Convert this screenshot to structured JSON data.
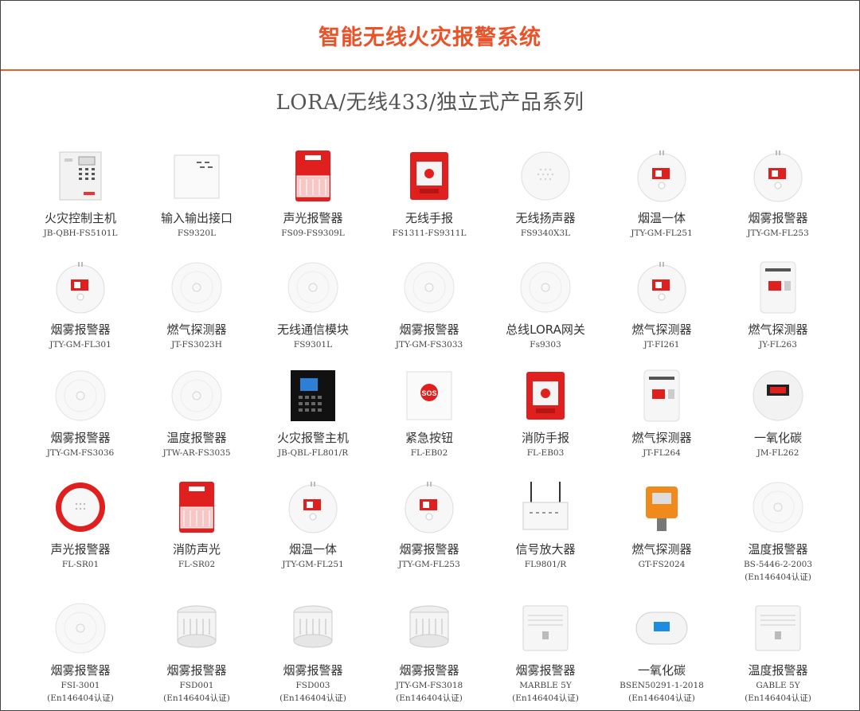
{
  "header": {
    "title": "智能无线火灾报警系统"
  },
  "subtitle": "LORA/无线433/独立式产品系列",
  "products": [
    {
      "name": "火灾控制主机",
      "model": "JB-QBH-FS5101L",
      "icon": "control-panel-icon"
    },
    {
      "name": "输入输出接口",
      "model": "FS9320L",
      "icon": "io-module-icon"
    },
    {
      "name": "声光报警器",
      "model": "FS09-FS9309L",
      "icon": "red-strobe-icon"
    },
    {
      "name": "无线手报",
      "model": "FS1311-FS9311L",
      "icon": "manual-call-point-icon"
    },
    {
      "name": "无线扬声器",
      "model": "FS9340X3L",
      "icon": "speaker-icon"
    },
    {
      "name": "烟温一体",
      "model": "JTY-GM-FL251",
      "icon": "smoke-detector-icon"
    },
    {
      "name": "烟雾报警器",
      "model": "JTY-GM-FL253",
      "icon": "smoke-detector-icon"
    },
    {
      "name": "烟雾报警器",
      "model": "JTY-GM-FL301",
      "icon": "smoke-detector-icon"
    },
    {
      "name": "燃气探测器",
      "model": "JT-FS3023H",
      "icon": "round-detector-icon"
    },
    {
      "name": "无线通信模块",
      "model": "FS9301L",
      "icon": "round-detector-icon"
    },
    {
      "name": "烟雾报警器",
      "model": "JTY-GM-FS3033",
      "icon": "round-detector-icon"
    },
    {
      "name": "总线LORA网关",
      "model": "Fs9303",
      "icon": "round-detector-icon"
    },
    {
      "name": "燃气探测器",
      "model": "JT-FI261",
      "icon": "smoke-detector-icon"
    },
    {
      "name": "燃气探测器",
      "model": "JY-FL263",
      "icon": "gas-detector-box-icon"
    },
    {
      "name": "烟雾报警器",
      "model": "JTY-GM-FS3036",
      "icon": "round-detector-icon"
    },
    {
      "name": "温度报警器",
      "model": "JTW-AR-FS3035",
      "icon": "round-detector-icon"
    },
    {
      "name": "火灾报警主机",
      "model": "JB-QBL-FL801/R",
      "icon": "alarm-host-icon"
    },
    {
      "name": "紧急按钮",
      "model": "FL-EB02",
      "icon": "sos-button-icon"
    },
    {
      "name": "消防手报",
      "model": "FL-EB03",
      "icon": "manual-call-point-icon"
    },
    {
      "name": "燃气探测器",
      "model": "JT-FL264",
      "icon": "gas-detector-box-icon"
    },
    {
      "name": "一氧化碳",
      "model": "JM-FL262",
      "icon": "co-detector-icon"
    },
    {
      "name": "声光报警器",
      "model": "FL-SR01",
      "icon": "round-siren-icon"
    },
    {
      "name": "消防声光",
      "model": "FL-SR02",
      "icon": "red-strobe-icon"
    },
    {
      "name": "烟温一体",
      "model": "JTY-GM-FL251",
      "icon": "smoke-detector-icon"
    },
    {
      "name": "烟雾报警器",
      "model": "JTY-GM-FL253",
      "icon": "smoke-detector-icon"
    },
    {
      "name": "信号放大器",
      "model": "FL9801/R",
      "icon": "router-icon"
    },
    {
      "name": "燃气探测器",
      "model": "GT-FS2024",
      "icon": "industrial-gas-detector-icon"
    },
    {
      "name": "温度报警器",
      "model": "BS-5446-2-2003",
      "model2": "(En146404认证)",
      "icon": "round-detector-icon"
    },
    {
      "name": "烟雾报警器",
      "model": "FSI-3001",
      "model2": "(En146404认证)",
      "icon": "round-detector-icon"
    },
    {
      "name": "烟雾报警器",
      "model": "FSD001",
      "model2": "(En146404认证)",
      "icon": "cylinder-detector-icon"
    },
    {
      "name": "烟雾报警器",
      "model": "FSD003",
      "model2": "(En146404认证)",
      "icon": "cylinder-detector-icon"
    },
    {
      "name": "烟雾报警器",
      "model": "JTY-GM-FS3018",
      "model2": "(En146404认证)",
      "icon": "cylinder-detector-icon"
    },
    {
      "name": "烟雾报警器",
      "model": "MARBLE 5Y",
      "model2": "(En146404认证)",
      "icon": "square-detector-icon"
    },
    {
      "name": "一氧化碳",
      "model": "BSEN50291-1-2018",
      "model2": "(En146404认证)",
      "icon": "oval-co-detector-icon"
    },
    {
      "name": "温度报警器",
      "model": "GABLE 5Y",
      "model2": "(En146404认证)",
      "icon": "square-detector-icon"
    }
  ]
}
